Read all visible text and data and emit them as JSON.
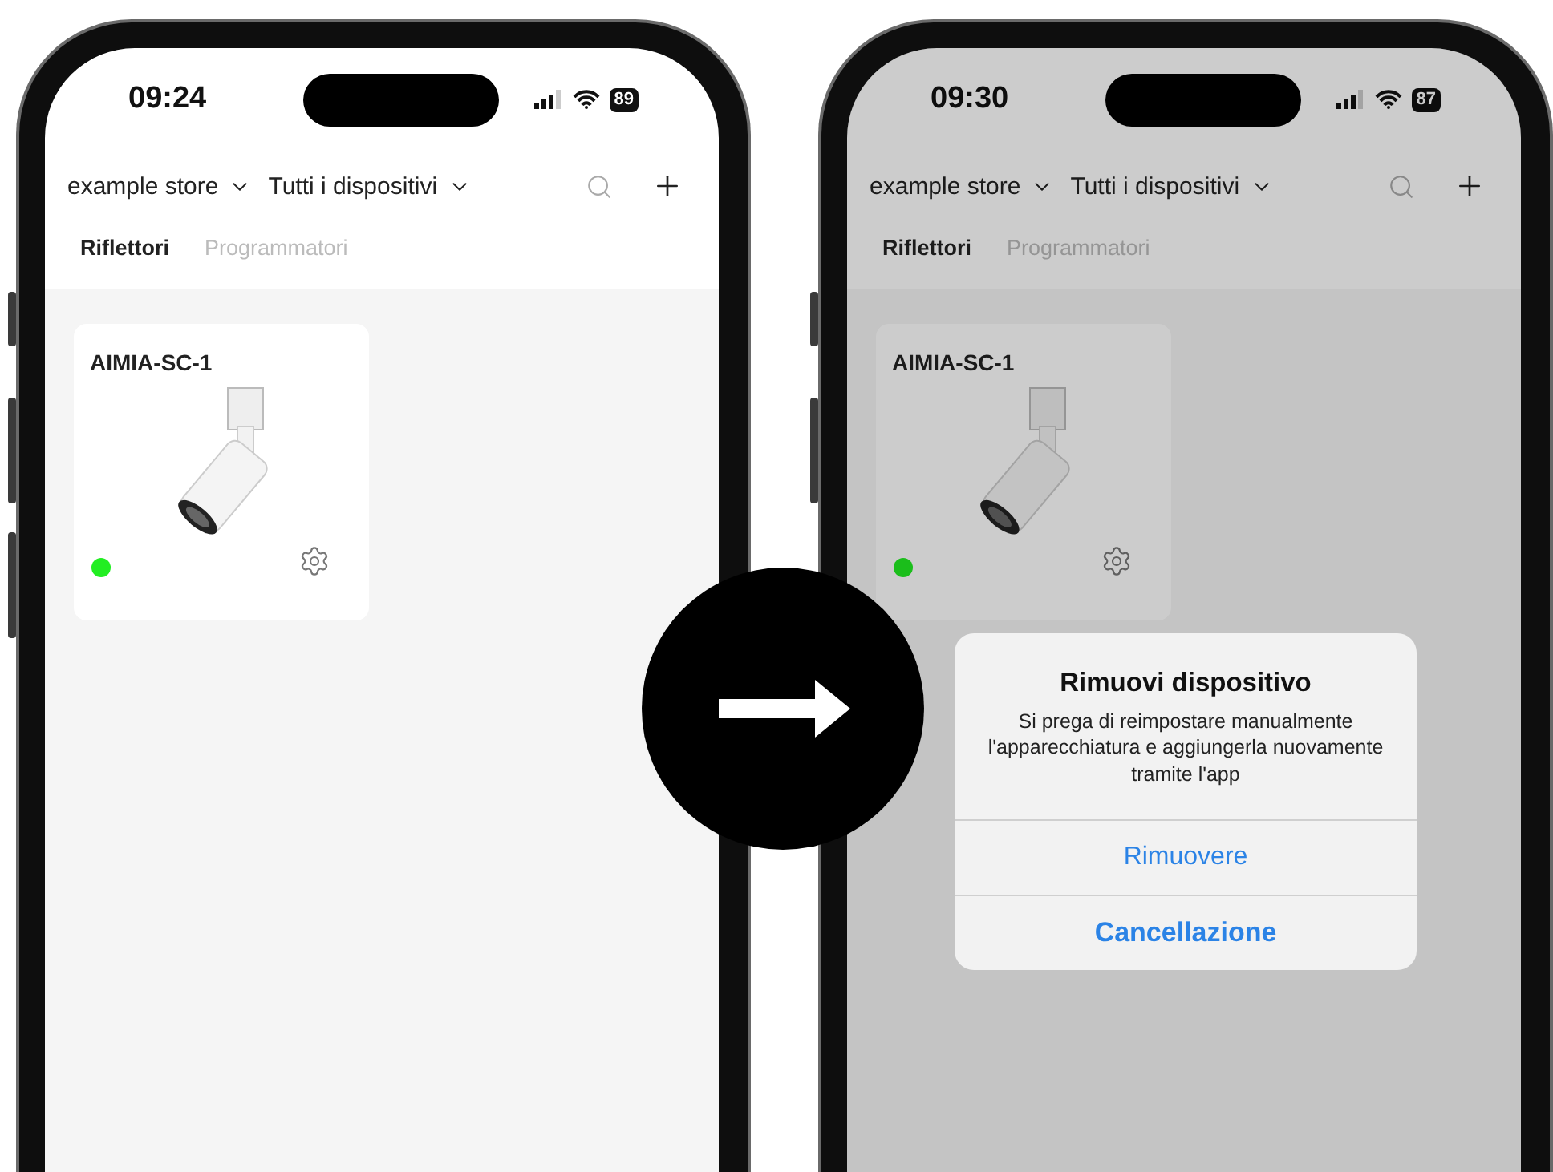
{
  "phones": [
    {
      "time": "09:24",
      "battery": "89",
      "store": "example store",
      "filter": "Tutti i dispositivi",
      "tabs": [
        {
          "label": "Riflettori",
          "selected": true
        },
        {
          "label": "Programmatori",
          "selected": false
        }
      ],
      "devices": [
        {
          "name": "AIMIA-SC-1",
          "online": true
        }
      ],
      "dimmed": false
    },
    {
      "time": "09:30",
      "battery": "87",
      "store": "example store",
      "filter": "Tutti i dispositivi",
      "tabs": [
        {
          "label": "Riflettori",
          "selected": true
        },
        {
          "label": "Programmatori",
          "selected": false
        }
      ],
      "devices": [
        {
          "name": "AIMIA-SC-1",
          "online": true
        }
      ],
      "dimmed": true,
      "dialog": {
        "title": "Rimuovi dispositivo",
        "message": "Si prega di reimpostare manualmente l'apparecchiatura e aggiungerla nuovamente tramite l'app",
        "actions": [
          {
            "label": "Rimuovere",
            "kind": "default"
          },
          {
            "label": "Cancellazione",
            "kind": "cancel"
          }
        ]
      }
    }
  ]
}
